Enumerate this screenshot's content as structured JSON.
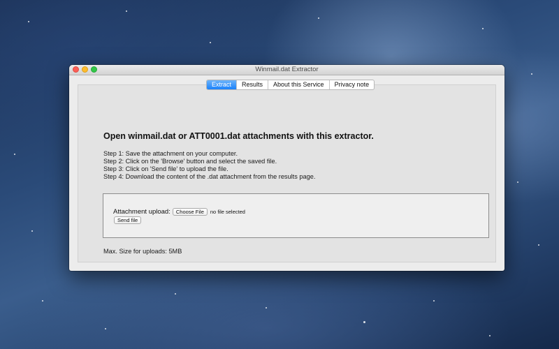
{
  "window": {
    "title": "Winmail.dat Extractor"
  },
  "tabs": [
    {
      "label": "Extract",
      "active": true
    },
    {
      "label": "Results",
      "active": false
    },
    {
      "label": "About this Service",
      "active": false
    },
    {
      "label": "Privacy note",
      "active": false
    }
  ],
  "main": {
    "heading": "Open winmail.dat or ATT0001.dat attachments with this extractor.",
    "steps": [
      "Step 1: Save the attachment on your computer.",
      "Step 2: Click on the 'Browse' button and select the saved file.",
      "Step 3: Click on 'Send file' to upload the file.",
      "Step 4: Download the content of the .dat attachment from the results page."
    ],
    "upload": {
      "label": "Attachment upload:",
      "choose_button": "Choose File",
      "file_status": "no file selected",
      "send_button": "Send file"
    },
    "max_size": "Max. Size for uploads: 5MB"
  },
  "colors": {
    "accent_tab": "#1a82fb",
    "close": "#fc5f57",
    "minimize": "#fdbc2e",
    "maximize": "#33c748"
  }
}
